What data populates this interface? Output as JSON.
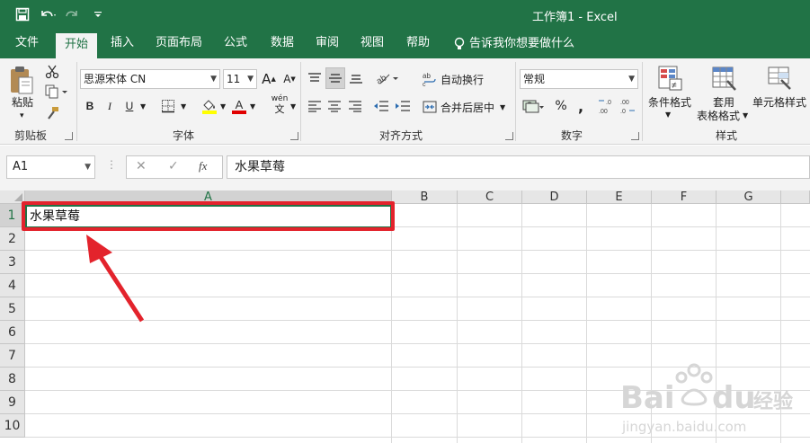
{
  "window": {
    "title": "工作簿1  -  Excel"
  },
  "tabs": [
    "文件",
    "开始",
    "插入",
    "页面布局",
    "公式",
    "数据",
    "审阅",
    "视图",
    "帮助"
  ],
  "active_tab": "开始",
  "tell_me": "告诉我你想要做什么",
  "clipboard": {
    "paste": "粘贴",
    "label": "剪贴板"
  },
  "font": {
    "name": "思源宋体 CN",
    "size": "11",
    "bold": "B",
    "italic": "I",
    "underline": "U",
    "label": "字体",
    "phonetic": "wén",
    "phonetic_char": "文"
  },
  "alignment": {
    "wrap": "自动换行",
    "merge": "合并后居中",
    "label": "对齐方式"
  },
  "number": {
    "format": "常规",
    "percent": "%",
    "comma": ",",
    "label": "数字"
  },
  "styles": {
    "conditional": "条件格式",
    "table_format_1": "套用",
    "table_format_2": "表格格式",
    "cell_style": "单元格样式",
    "label": "样式"
  },
  "formula_bar": {
    "name_box": "A1",
    "fx": "fx",
    "content": "水果草莓"
  },
  "columns": [
    "A",
    "B",
    "C",
    "D",
    "E",
    "F",
    "G"
  ],
  "rows": [
    "1",
    "2",
    "3",
    "4",
    "5",
    "6",
    "7",
    "8",
    "9",
    "10"
  ],
  "cells": {
    "A1": "水果草莓"
  },
  "colors": {
    "accent": "#217346",
    "highlight": "#e3232c"
  }
}
